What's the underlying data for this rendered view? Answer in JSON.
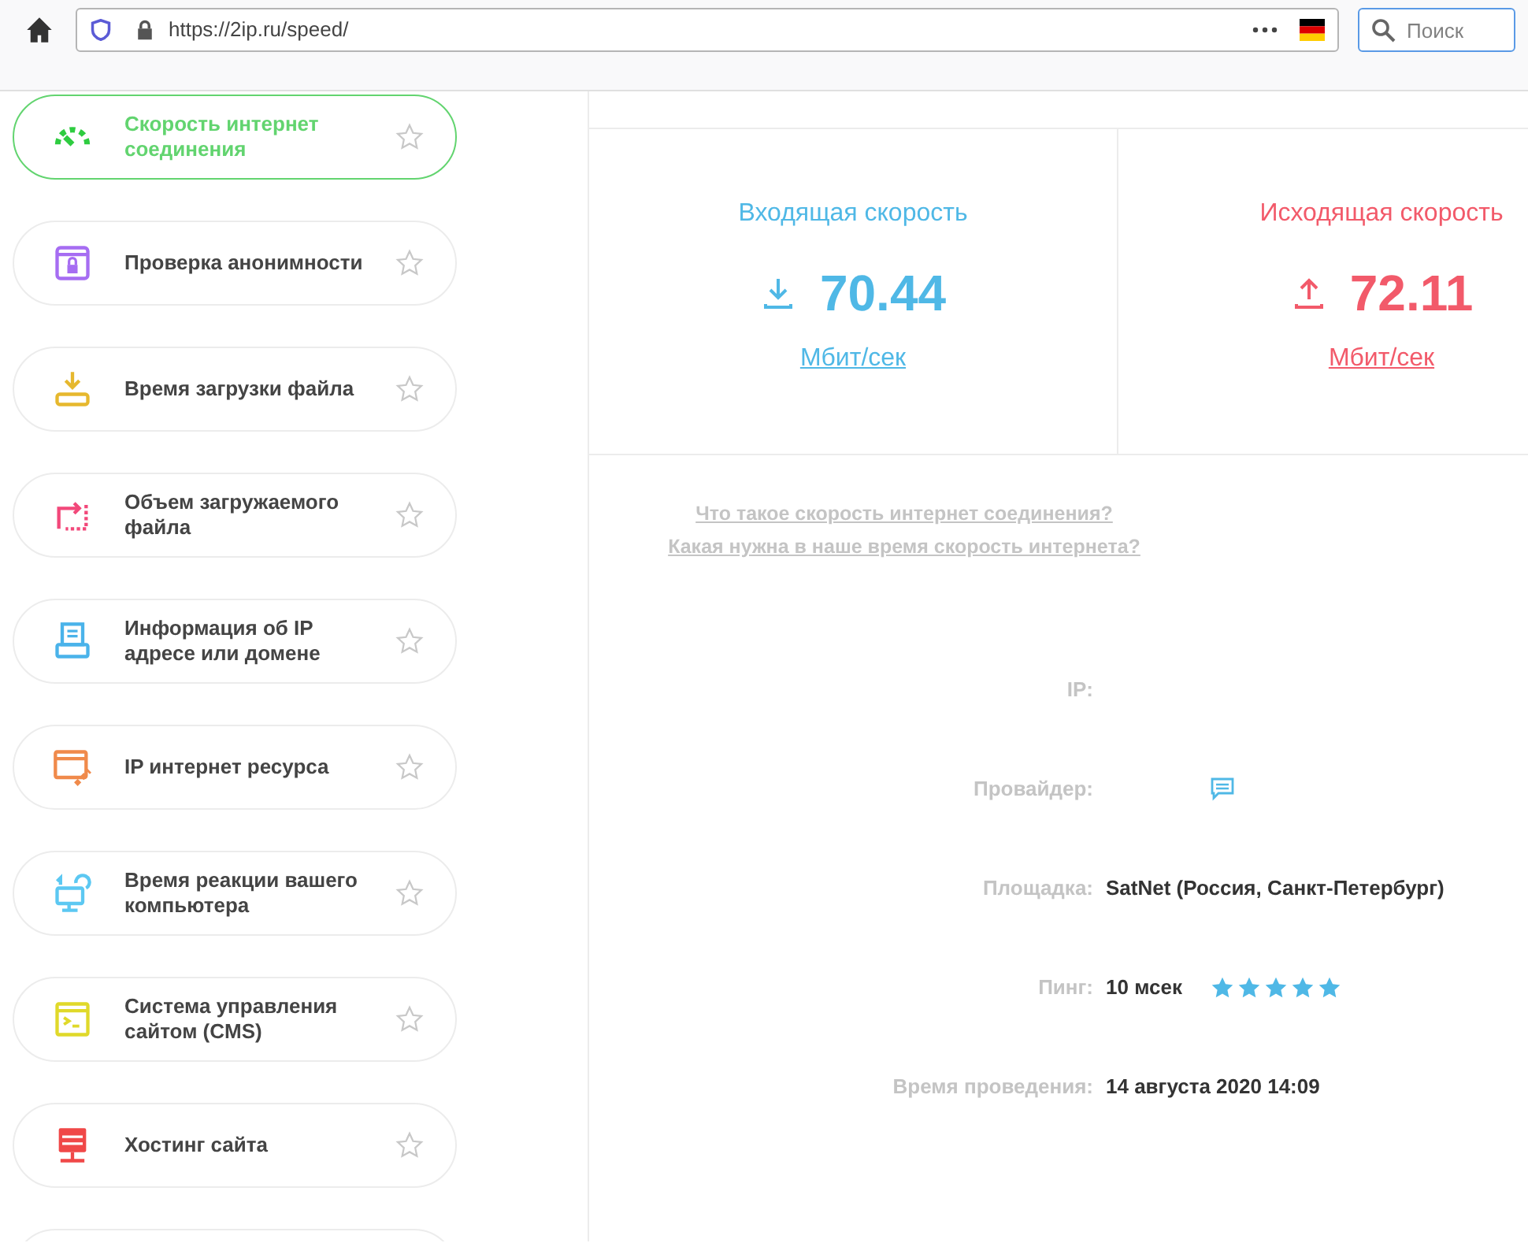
{
  "browser": {
    "url": "https://2ip.ru/speed/",
    "search": {
      "placeholder": "Поиск"
    }
  },
  "sidebar": {
    "items": [
      {
        "label": "Скорость интернет соединения",
        "selected": true,
        "color": "#2ecc40"
      },
      {
        "label": "Проверка анонимности",
        "selected": false,
        "color": "#a66df2"
      },
      {
        "label": "Время загрузки файла",
        "selected": false,
        "color": "#e6b82e"
      },
      {
        "label": "Объем загружаемого файла",
        "selected": false,
        "color": "#f2487a"
      },
      {
        "label": "Информация об IP адресе или домене",
        "selected": false,
        "color": "#4ab3ea"
      },
      {
        "label": "IP интернет ресурса",
        "selected": false,
        "color": "#f08a4b"
      },
      {
        "label": "Время реакции вашего компьютера",
        "selected": false,
        "color": "#5cc8f2"
      },
      {
        "label": "Система управления сайтом (CMS)",
        "selected": false,
        "color": "#e0d92a"
      },
      {
        "label": "Хостинг сайта",
        "selected": false,
        "color": "#f04848"
      }
    ]
  },
  "speeds": [
    {
      "kind": "download",
      "title": "Входящая скорость",
      "value": "70.44",
      "unit": "Мбит/сек",
      "color": "#4fb8e6"
    },
    {
      "kind": "upload",
      "title": "Исходящая скорость",
      "value": "72.11",
      "unit": "Мбит/сек",
      "color": "#f25a6a"
    }
  ],
  "links": [
    "Что такое скорость интернет соединения?",
    "Какая нужна в наше время скорость интернета?"
  ],
  "details": [
    {
      "kind": "text",
      "label": "IP:"
    },
    {
      "kind": "comment",
      "label": "Провайдер:"
    },
    {
      "kind": "text",
      "label": "Площадка:",
      "value": "SatNet (Россия, Санкт-Петербург)"
    },
    {
      "kind": "rating",
      "label": "Пинг:",
      "value": "10 мсек",
      "stars": 5
    },
    {
      "kind": "text",
      "label": "Время проведения:",
      "value": "14 августа 2020 14:09"
    }
  ]
}
